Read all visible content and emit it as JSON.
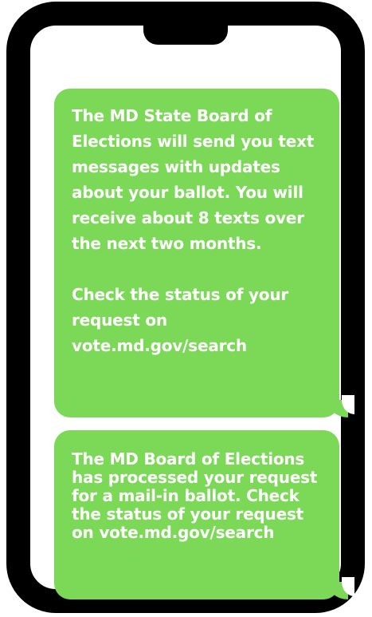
{
  "messages": [
    {
      "paragraph_1": "The MD State Board of Elections will send you text messages with updates about your ballot. You will receive about 8 texts over the next two months.",
      "paragraph_2": "Check the status of your request on vote.md.gov/search"
    },
    {
      "text": "The MD Board of Elections has processed your request for a mail-in ballot. Check the status of your request on vote.md.gov/search"
    }
  ],
  "colors": {
    "bubble": "#7bd957",
    "phone_frame": "#000000",
    "text": "#ffffff"
  }
}
